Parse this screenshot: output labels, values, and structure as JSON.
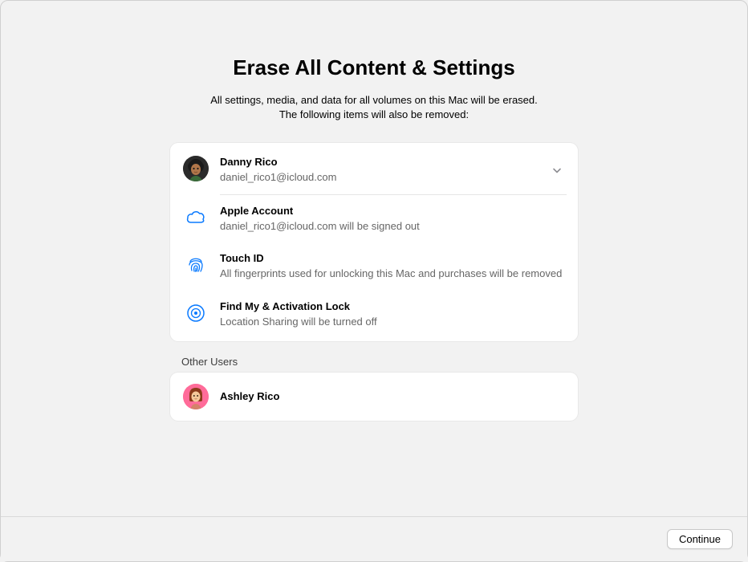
{
  "title": "Erase All Content & Settings",
  "subtitle_line1": "All settings, media, and data for all volumes on this Mac will be erased.",
  "subtitle_line2": "The following items will also be removed:",
  "user": {
    "name": "Danny Rico",
    "email": "daniel_rico1@icloud.com"
  },
  "items": {
    "apple_account": {
      "title": "Apple Account",
      "sub": "daniel_rico1@icloud.com will be signed out"
    },
    "touch_id": {
      "title": "Touch ID",
      "sub": "All fingerprints used for unlocking this Mac and purchases will be removed"
    },
    "find_my": {
      "title": "Find My & Activation Lock",
      "sub": "Location Sharing will be turned off"
    }
  },
  "other_users_label": "Other Users",
  "other_users": {
    "0": {
      "name": "Ashley Rico"
    }
  },
  "footer": {
    "continue_label": "Continue"
  }
}
